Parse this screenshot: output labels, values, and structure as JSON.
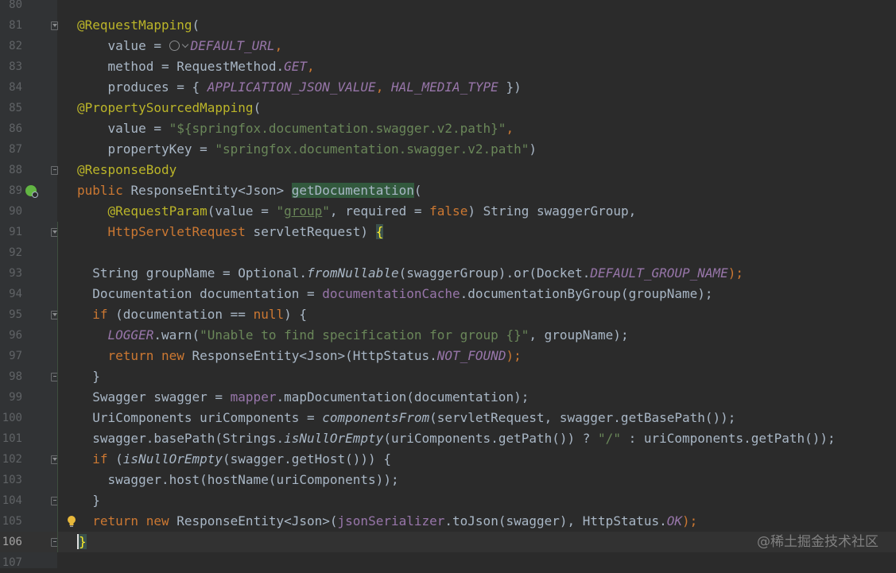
{
  "editor": {
    "current_line": 106,
    "lines": [
      {
        "n": "80",
        "tokens": []
      },
      {
        "n": "81",
        "tokens": [
          {
            "t": "@RequestMapping",
            "c": "ann"
          },
          {
            "t": "(",
            "c": ""
          }
        ]
      },
      {
        "n": "82",
        "tokens": [
          {
            "t": "    value = ",
            "c": ""
          },
          {
            "t": "",
            "c": "globe"
          },
          {
            "t": "DEFAULT_URL",
            "c": "const"
          },
          {
            "t": ",",
            "c": "kw"
          }
        ]
      },
      {
        "n": "83",
        "tokens": [
          {
            "t": "    method = RequestMethod.",
            "c": ""
          },
          {
            "t": "GET",
            "c": "const"
          },
          {
            "t": ",",
            "c": "kw"
          }
        ]
      },
      {
        "n": "84",
        "tokens": [
          {
            "t": "    produces = { ",
            "c": ""
          },
          {
            "t": "APPLICATION_JSON_VALUE",
            "c": "const"
          },
          {
            "t": ", ",
            "c": "kw"
          },
          {
            "t": "HAL_MEDIA_TYPE",
            "c": "const"
          },
          {
            "t": " })",
            "c": ""
          }
        ]
      },
      {
        "n": "85",
        "tokens": [
          {
            "t": "@PropertySourcedMapping",
            "c": "ann"
          },
          {
            "t": "(",
            "c": ""
          }
        ]
      },
      {
        "n": "86",
        "tokens": [
          {
            "t": "    value = ",
            "c": ""
          },
          {
            "t": "\"${springfox.documentation.swagger.v2.path}\"",
            "c": "str"
          },
          {
            "t": ",",
            "c": "kw"
          }
        ]
      },
      {
        "n": "87",
        "tokens": [
          {
            "t": "    propertyKey = ",
            "c": ""
          },
          {
            "t": "\"springfox.documentation.swagger.v2.path\"",
            "c": "str"
          },
          {
            "t": ")",
            "c": ""
          }
        ]
      },
      {
        "n": "88",
        "tokens": [
          {
            "t": "@ResponseBody",
            "c": "ann"
          }
        ]
      },
      {
        "n": "89",
        "tokens": [
          {
            "t": "public ",
            "c": "kw"
          },
          {
            "t": "ResponseEntity<Json> ",
            "c": ""
          },
          {
            "t": "getDocumentation",
            "c": "hl"
          },
          {
            "t": "(",
            "c": ""
          }
        ]
      },
      {
        "n": "90",
        "tokens": [
          {
            "t": "    ",
            "c": ""
          },
          {
            "t": "@RequestParam",
            "c": "ann"
          },
          {
            "t": "(value = ",
            "c": ""
          },
          {
            "t": "\"",
            "c": "str"
          },
          {
            "t": "group",
            "c": "strul"
          },
          {
            "t": "\"",
            "c": "str"
          },
          {
            "t": ", required = ",
            "c": ""
          },
          {
            "t": "false",
            "c": "kw"
          },
          {
            "t": ") String swaggerGroup,",
            "c": ""
          }
        ]
      },
      {
        "n": "91",
        "tokens": [
          {
            "t": "    ",
            "c": ""
          },
          {
            "t": "HttpServletRequest",
            "c": "redtype"
          },
          {
            "t": " servletRequest) ",
            "c": ""
          },
          {
            "t": "{",
            "c": "brace"
          }
        ]
      },
      {
        "n": "92",
        "tokens": []
      },
      {
        "n": "93",
        "tokens": [
          {
            "t": "  String groupName = Optional.",
            "c": ""
          },
          {
            "t": "fromNullable",
            "c": "static"
          },
          {
            "t": "(swaggerGroup).or(Docket.",
            "c": ""
          },
          {
            "t": "DEFAULT_GROUP_NAME",
            "c": "const"
          },
          {
            "t": ");",
            "c": "kw"
          }
        ]
      },
      {
        "n": "94",
        "tokens": [
          {
            "t": "  Documentation documentation = ",
            "c": ""
          },
          {
            "t": "documentationCache",
            "c": "field"
          },
          {
            "t": ".documentationByGroup(groupName);",
            "c": ""
          }
        ]
      },
      {
        "n": "95",
        "tokens": [
          {
            "t": "  ",
            "c": ""
          },
          {
            "t": "if",
            "c": "kw"
          },
          {
            "t": " (documentation == ",
            "c": ""
          },
          {
            "t": "null",
            "c": "kw"
          },
          {
            "t": ") {",
            "c": ""
          }
        ]
      },
      {
        "n": "96",
        "tokens": [
          {
            "t": "    ",
            "c": ""
          },
          {
            "t": "LOGGER",
            "c": "const"
          },
          {
            "t": ".warn(",
            "c": ""
          },
          {
            "t": "\"Unable to find specification for group {}\"",
            "c": "str"
          },
          {
            "t": ", groupName);",
            "c": ""
          }
        ]
      },
      {
        "n": "97",
        "tokens": [
          {
            "t": "    ",
            "c": ""
          },
          {
            "t": "return new ",
            "c": "kw"
          },
          {
            "t": "ResponseEntity<Json>(HttpStatus.",
            "c": ""
          },
          {
            "t": "NOT_FOUND",
            "c": "const"
          },
          {
            "t": ");",
            "c": "kw"
          }
        ]
      },
      {
        "n": "98",
        "tokens": [
          {
            "t": "  }",
            "c": ""
          }
        ]
      },
      {
        "n": "99",
        "tokens": [
          {
            "t": "  Swagger swagger = ",
            "c": ""
          },
          {
            "t": "mapper",
            "c": "field"
          },
          {
            "t": ".mapDocumentation(documentation);",
            "c": ""
          }
        ]
      },
      {
        "n": "100",
        "tokens": [
          {
            "t": "  UriComponents uriComponents = ",
            "c": ""
          },
          {
            "t": "componentsFrom",
            "c": "static"
          },
          {
            "t": "(servletRequest, swagger.getBasePath());",
            "c": ""
          }
        ]
      },
      {
        "n": "101",
        "tokens": [
          {
            "t": "  swagger.basePath(Strings.",
            "c": ""
          },
          {
            "t": "isNullOrEmpty",
            "c": "static"
          },
          {
            "t": "(uriComponents.getPath()) ? ",
            "c": ""
          },
          {
            "t": "\"/\"",
            "c": "str"
          },
          {
            "t": " : uriComponents.getPath());",
            "c": ""
          }
        ]
      },
      {
        "n": "102",
        "tokens": [
          {
            "t": "  ",
            "c": ""
          },
          {
            "t": "if",
            "c": "kw"
          },
          {
            "t": " (",
            "c": ""
          },
          {
            "t": "isNullOrEmpty",
            "c": "static"
          },
          {
            "t": "(swagger.getHost())) {",
            "c": ""
          }
        ]
      },
      {
        "n": "103",
        "tokens": [
          {
            "t": "    swagger.host(hostName(uriComponents));",
            "c": ""
          }
        ]
      },
      {
        "n": "104",
        "tokens": [
          {
            "t": "  }",
            "c": ""
          }
        ]
      },
      {
        "n": "105",
        "tokens": [
          {
            "t": "  ",
            "c": ""
          },
          {
            "t": "return new ",
            "c": "kw"
          },
          {
            "t": "ResponseEntity<Json>(",
            "c": ""
          },
          {
            "t": "jsonSerializer",
            "c": "field"
          },
          {
            "t": ".toJson(swagger), HttpStatus.",
            "c": ""
          },
          {
            "t": "OK",
            "c": "const"
          },
          {
            "t": ");",
            "c": "kw"
          }
        ]
      },
      {
        "n": "106",
        "tokens": [
          {
            "t": "}",
            "c": "brace"
          }
        ]
      },
      {
        "n": "107",
        "tokens": []
      }
    ]
  },
  "gutter_icons": {
    "fold_lines": [
      {
        "n": "81",
        "kind": "down"
      },
      {
        "n": "88",
        "kind": "end"
      },
      {
        "n": "91",
        "kind": "down"
      },
      {
        "n": "95",
        "kind": "down"
      },
      {
        "n": "98",
        "kind": "end"
      },
      {
        "n": "102",
        "kind": "down"
      },
      {
        "n": "104",
        "kind": "end"
      },
      {
        "n": "106",
        "kind": "end"
      }
    ],
    "bean_icon_line": "89",
    "bulb_icon_line": "105"
  },
  "watermark": "@稀土掘金技术社区"
}
